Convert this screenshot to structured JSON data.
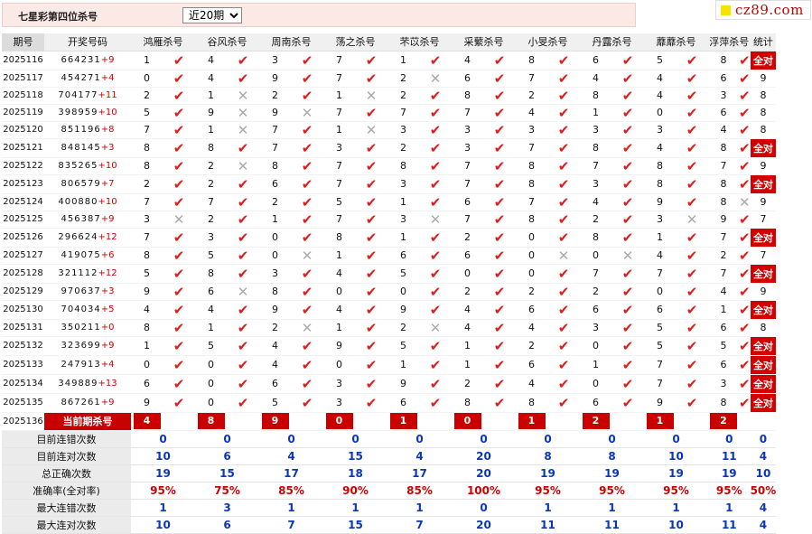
{
  "header": {
    "title": "七星彩第四位杀号",
    "period_select": "近20期",
    "logo_text": "cz89.com"
  },
  "columns": {
    "issue": "期号",
    "draw": "开奖号码",
    "experts": [
      "鸿雁杀号",
      "谷风杀号",
      "周南杀号",
      "荡之杀号",
      "芣苡杀号",
      "采蘩杀号",
      "小旻杀号",
      "丹露杀号",
      "蘼蘼杀号",
      "浮萍杀号"
    ],
    "stats": "统计"
  },
  "rows": [
    {
      "issue": "2025116",
      "digits": "664231",
      "sum": "+9",
      "kills": [
        "1",
        "4",
        "3",
        "7",
        "1",
        "4",
        "8",
        "6",
        "5",
        "8"
      ],
      "marks": [
        1,
        1,
        1,
        1,
        1,
        1,
        1,
        1,
        1,
        1
      ],
      "stat": "全对"
    },
    {
      "issue": "2025117",
      "digits": "454271",
      "sum": "+4",
      "kills": [
        "0",
        "4",
        "9",
        "7",
        "2",
        "6",
        "7",
        "4",
        "4",
        "6"
      ],
      "marks": [
        1,
        1,
        1,
        1,
        0,
        1,
        1,
        1,
        1,
        1
      ],
      "stat": "9"
    },
    {
      "issue": "2025118",
      "digits": "704177",
      "sum": "+11",
      "kills": [
        "2",
        "1",
        "2",
        "1",
        "2",
        "8",
        "2",
        "8",
        "4",
        "3"
      ],
      "marks": [
        1,
        0,
        1,
        0,
        1,
        1,
        1,
        1,
        1,
        1
      ],
      "stat": "8"
    },
    {
      "issue": "2025119",
      "digits": "398959",
      "sum": "+10",
      "kills": [
        "5",
        "9",
        "9",
        "7",
        "7",
        "7",
        "4",
        "1",
        "0",
        "6"
      ],
      "marks": [
        1,
        0,
        0,
        1,
        1,
        1,
        1,
        1,
        1,
        1
      ],
      "stat": "8"
    },
    {
      "issue": "2025120",
      "digits": "851196",
      "sum": "+8",
      "kills": [
        "7",
        "1",
        "7",
        "1",
        "3",
        "3",
        "3",
        "3",
        "3",
        "4"
      ],
      "marks": [
        1,
        0,
        1,
        0,
        1,
        1,
        1,
        1,
        1,
        1
      ],
      "stat": "8"
    },
    {
      "issue": "2025121",
      "digits": "848145",
      "sum": "+3",
      "kills": [
        "8",
        "8",
        "7",
        "3",
        "2",
        "3",
        "7",
        "8",
        "4",
        "8"
      ],
      "marks": [
        1,
        1,
        1,
        1,
        1,
        1,
        1,
        1,
        1,
        1
      ],
      "stat": "全对"
    },
    {
      "issue": "2025122",
      "digits": "835265",
      "sum": "+10",
      "kills": [
        "8",
        "2",
        "8",
        "7",
        "8",
        "7",
        "8",
        "7",
        "8",
        "7"
      ],
      "marks": [
        1,
        0,
        1,
        1,
        1,
        1,
        1,
        1,
        1,
        1
      ],
      "stat": "9"
    },
    {
      "issue": "2025123",
      "digits": "806579",
      "sum": "+7",
      "kills": [
        "2",
        "2",
        "6",
        "7",
        "3",
        "7",
        "8",
        "3",
        "8",
        "8"
      ],
      "marks": [
        1,
        1,
        1,
        1,
        1,
        1,
        1,
        1,
        1,
        1
      ],
      "stat": "全对"
    },
    {
      "issue": "2025124",
      "digits": "400880",
      "sum": "+10",
      "kills": [
        "7",
        "7",
        "2",
        "5",
        "1",
        "6",
        "7",
        "4",
        "9",
        "8"
      ],
      "marks": [
        1,
        1,
        1,
        1,
        1,
        1,
        1,
        1,
        1,
        0
      ],
      "stat": "9"
    },
    {
      "issue": "2025125",
      "digits": "456387",
      "sum": "+9",
      "kills": [
        "3",
        "2",
        "1",
        "7",
        "3",
        "7",
        "8",
        "2",
        "3",
        "9"
      ],
      "marks": [
        0,
        1,
        1,
        1,
        0,
        1,
        1,
        1,
        0,
        1
      ],
      "stat": "7"
    },
    {
      "issue": "2025126",
      "digits": "296624",
      "sum": "+12",
      "kills": [
        "7",
        "3",
        "0",
        "8",
        "1",
        "2",
        "0",
        "8",
        "1",
        "7"
      ],
      "marks": [
        1,
        1,
        1,
        1,
        1,
        1,
        1,
        1,
        1,
        1
      ],
      "stat": "全对"
    },
    {
      "issue": "2025127",
      "digits": "419075",
      "sum": "+6",
      "kills": [
        "8",
        "5",
        "0",
        "1",
        "6",
        "6",
        "0",
        "0",
        "4",
        "2"
      ],
      "marks": [
        1,
        1,
        0,
        1,
        1,
        1,
        0,
        0,
        1,
        1
      ],
      "stat": "7"
    },
    {
      "issue": "2025128",
      "digits": "321112",
      "sum": "+12",
      "kills": [
        "5",
        "8",
        "3",
        "4",
        "5",
        "0",
        "0",
        "7",
        "7",
        "7"
      ],
      "marks": [
        1,
        1,
        1,
        1,
        1,
        1,
        1,
        1,
        1,
        1
      ],
      "stat": "全对"
    },
    {
      "issue": "2025129",
      "digits": "970637",
      "sum": "+3",
      "kills": [
        "9",
        "6",
        "8",
        "0",
        "0",
        "2",
        "2",
        "2",
        "0",
        "4"
      ],
      "marks": [
        1,
        0,
        1,
        1,
        1,
        1,
        1,
        1,
        1,
        1
      ],
      "stat": "9"
    },
    {
      "issue": "2025130",
      "digits": "704034",
      "sum": "+5",
      "kills": [
        "4",
        "4",
        "9",
        "4",
        "9",
        "4",
        "6",
        "6",
        "6",
        "1"
      ],
      "marks": [
        1,
        1,
        1,
        1,
        1,
        1,
        1,
        1,
        1,
        1
      ],
      "stat": "全对"
    },
    {
      "issue": "2025131",
      "digits": "350211",
      "sum": "+0",
      "kills": [
        "8",
        "1",
        "2",
        "1",
        "2",
        "4",
        "4",
        "3",
        "5",
        "6"
      ],
      "marks": [
        1,
        1,
        0,
        1,
        0,
        1,
        1,
        1,
        1,
        1
      ],
      "stat": "8"
    },
    {
      "issue": "2025132",
      "digits": "323699",
      "sum": "+9",
      "kills": [
        "1",
        "5",
        "4",
        "9",
        "5",
        "1",
        "2",
        "0",
        "5",
        "5"
      ],
      "marks": [
        1,
        1,
        1,
        1,
        1,
        1,
        1,
        1,
        1,
        1
      ],
      "stat": "全对"
    },
    {
      "issue": "2025133",
      "digits": "247913",
      "sum": "+4",
      "kills": [
        "0",
        "0",
        "4",
        "0",
        "1",
        "1",
        "6",
        "1",
        "7",
        "6"
      ],
      "marks": [
        1,
        1,
        1,
        1,
        1,
        1,
        1,
        1,
        1,
        1
      ],
      "stat": "全对"
    },
    {
      "issue": "2025134",
      "digits": "349889",
      "sum": "+13",
      "kills": [
        "6",
        "0",
        "6",
        "3",
        "9",
        "2",
        "4",
        "0",
        "7",
        "3"
      ],
      "marks": [
        1,
        1,
        1,
        1,
        1,
        1,
        1,
        1,
        1,
        1
      ],
      "stat": "全对"
    },
    {
      "issue": "2025135",
      "digits": "867261",
      "sum": "+9",
      "kills": [
        "9",
        "0",
        "5",
        "3",
        "6",
        "8",
        "8",
        "6",
        "9",
        "8"
      ],
      "marks": [
        1,
        1,
        1,
        1,
        1,
        1,
        1,
        1,
        1,
        1
      ],
      "stat": "全对"
    }
  ],
  "current": {
    "issue": "2025136",
    "label": "当前期杀号",
    "kills": [
      "4",
      "8",
      "9",
      "0",
      "1",
      "0",
      "1",
      "2",
      "1",
      "2"
    ]
  },
  "summary": [
    {
      "label": "目前连错次数",
      "values": [
        "0",
        "0",
        "0",
        "0",
        "0",
        "0",
        "0",
        "0",
        "0",
        "0"
      ],
      "stat": "0",
      "kind": "num"
    },
    {
      "label": "目前连对次数",
      "values": [
        "10",
        "6",
        "4",
        "15",
        "4",
        "20",
        "8",
        "8",
        "10",
        "11"
      ],
      "stat": "4",
      "kind": "num"
    },
    {
      "label": "总正确次数",
      "values": [
        "19",
        "15",
        "17",
        "18",
        "17",
        "20",
        "19",
        "19",
        "19",
        "19"
      ],
      "stat": "10",
      "kind": "num"
    },
    {
      "label": "准确率(全对率)",
      "values": [
        "95%",
        "75%",
        "85%",
        "90%",
        "85%",
        "100%",
        "95%",
        "95%",
        "95%",
        "95%"
      ],
      "stat": "50%",
      "kind": "pct"
    },
    {
      "label": "最大连错次数",
      "values": [
        "1",
        "3",
        "1",
        "1",
        "1",
        "0",
        "1",
        "1",
        "1",
        "1"
      ],
      "stat": "4",
      "kind": "num"
    },
    {
      "label": "最大连对次数",
      "values": [
        "10",
        "6",
        "7",
        "15",
        "7",
        "20",
        "11",
        "11",
        "10",
        "11"
      ],
      "stat": "4",
      "kind": "num"
    }
  ],
  "icons": {
    "correct": "check-icon",
    "wrong": "cross-icon"
  },
  "colors": {
    "accent": "#d20000",
    "summary_value": "#0a36b8",
    "header_bg": "#fbe9e5"
  }
}
